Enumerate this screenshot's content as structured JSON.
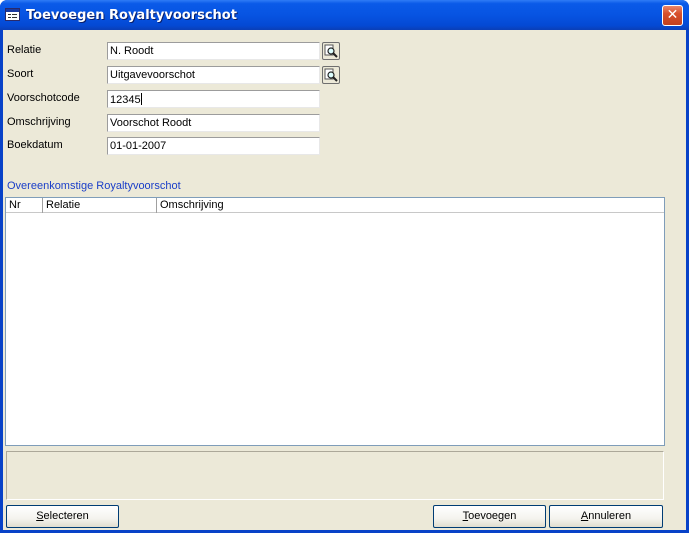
{
  "window": {
    "title": "Toevoegen Royaltyvoorschot",
    "close_glyph": "✕"
  },
  "form": {
    "relatie_label": "Relatie",
    "relatie_value": "N. Roodt",
    "soort_label": "Soort",
    "soort_value": "Uitgavevoorschot",
    "code_label": "Voorschotcode",
    "code_value": "12345",
    "omschrijving_label": "Omschrijving",
    "omschrijving_value": "Voorschot Roodt",
    "boekdatum_label": "Boekdatum",
    "boekdatum_value": "01-01-2007"
  },
  "list": {
    "title": "Overeenkomstige Royaltyvoorschot",
    "columns": [
      "Nr",
      "Relatie",
      "Omschrijving"
    ],
    "rows": []
  },
  "buttons": {
    "selecteren_mnemonic": "S",
    "selecteren_rest": "electeren",
    "toevoegen_mnemonic": "T",
    "toevoegen_rest": "oevoegen",
    "annuleren_mnemonic": "A",
    "annuleren_rest": "nnuleren"
  },
  "icons": {
    "window": "form-window-icon",
    "lookup": "magnifier-lookup-icon"
  },
  "colors": {
    "titlebar": "#0754e2",
    "client_bg": "#ece9d8",
    "section_title": "#1a3ec8"
  }
}
